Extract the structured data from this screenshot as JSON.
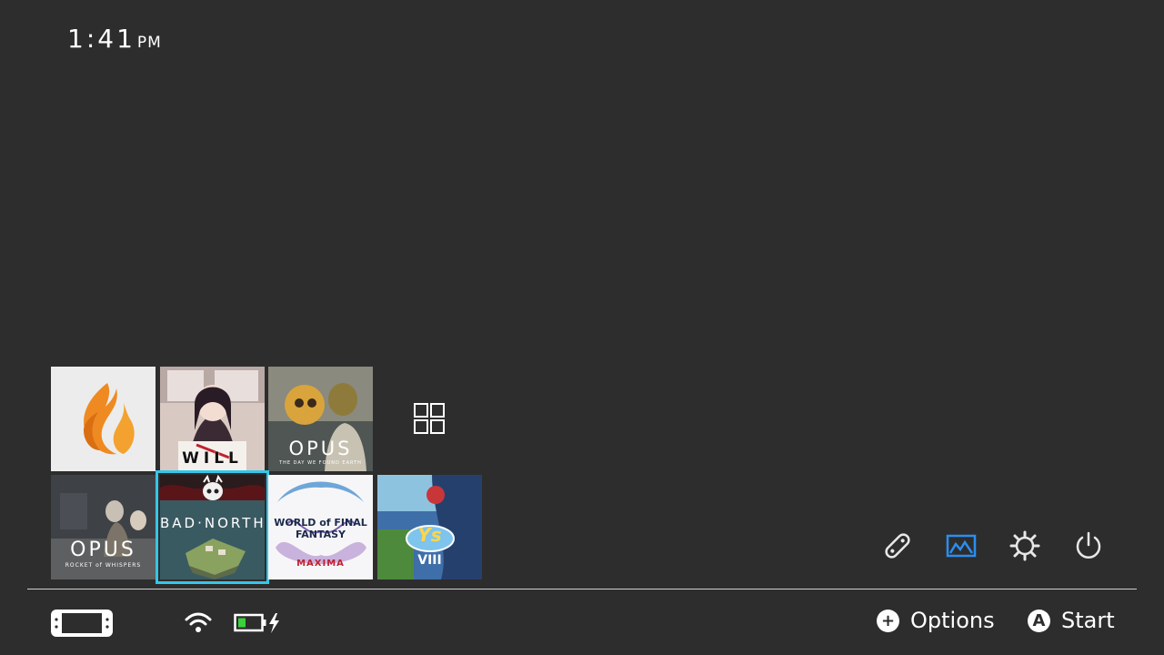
{
  "clock": {
    "time": "1:41",
    "ampm": "PM"
  },
  "games": [
    {
      "id": "flame",
      "title": "",
      "selected": false
    },
    {
      "id": "will",
      "title": "WILL",
      "selected": false
    },
    {
      "id": "opus1",
      "title": "OPUS",
      "subtitle": "THE DAY WE FOUND EARTH",
      "selected": false
    },
    {
      "id": "opus2",
      "title": "OPUS",
      "subtitle": "ROCKET of WHISPERS",
      "selected": false
    },
    {
      "id": "badnorth",
      "title": "BAD·NORTH",
      "selected": true
    },
    {
      "id": "wofff",
      "title": "WORLD of FINAL FANTASY",
      "subtitle": "MAXIMA",
      "selected": false
    },
    {
      "id": "ys8",
      "title": "Ys",
      "subtitle": "VIII",
      "selected": false
    }
  ],
  "system_icons": [
    "controllers-icon",
    "album-icon",
    "settings-icon",
    "power-icon"
  ],
  "footer": {
    "options_label": "Options",
    "start_label": "Start",
    "options_button": "+",
    "start_button": "A"
  },
  "colors": {
    "background": "#2d2d2d",
    "accent": "#35c6e8",
    "album_blue": "#2b8ef0",
    "battery_green": "#3ad13a"
  }
}
